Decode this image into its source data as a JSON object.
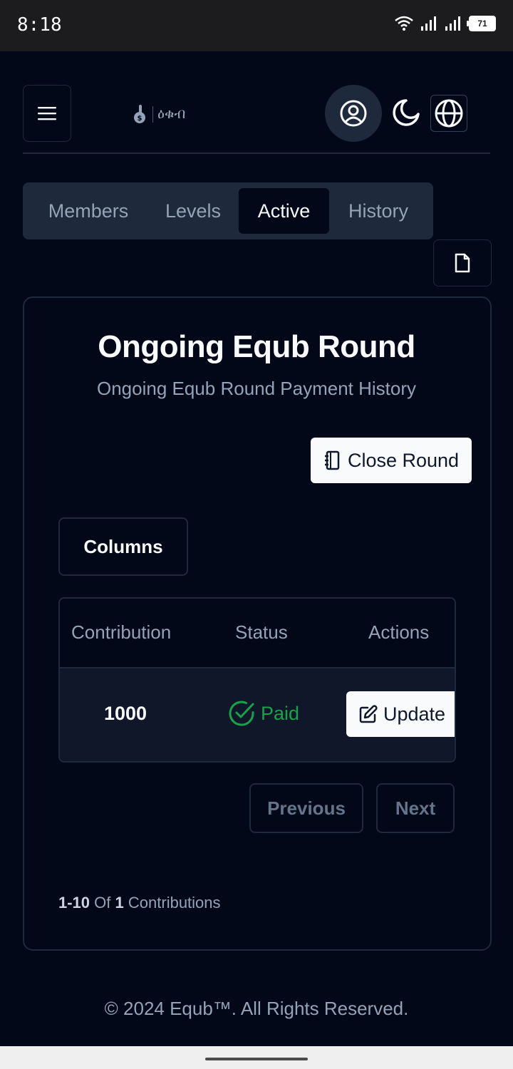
{
  "status_bar": {
    "time": "8:18",
    "battery": "71"
  },
  "header": {
    "logo_text": "ዕቁብ"
  },
  "tabs": [
    {
      "label": "Members"
    },
    {
      "label": "Levels"
    },
    {
      "label": "Active"
    },
    {
      "label": "History"
    }
  ],
  "card": {
    "title": "Ongoing Equb Round",
    "subtitle": "Ongoing Equb Round Payment History",
    "close_round_label": "Close Round",
    "columns_label": "Columns"
  },
  "table": {
    "headers": [
      "Contribution",
      "Status",
      "Actions"
    ],
    "rows": [
      {
        "contribution": "1000",
        "status": "Paid",
        "action": "Update"
      }
    ]
  },
  "pagination": {
    "previous_label": "Previous",
    "next_label": "Next",
    "range": "1-10",
    "of_label": "Of",
    "total": "1",
    "unit": "Contributions"
  },
  "footer": {
    "text": "© 2024 Equb™. All Rights Reserved."
  },
  "colors": {
    "background": "#020817",
    "muted": "#94a3b8",
    "success": "#16a34a",
    "border": "#1e293b"
  }
}
